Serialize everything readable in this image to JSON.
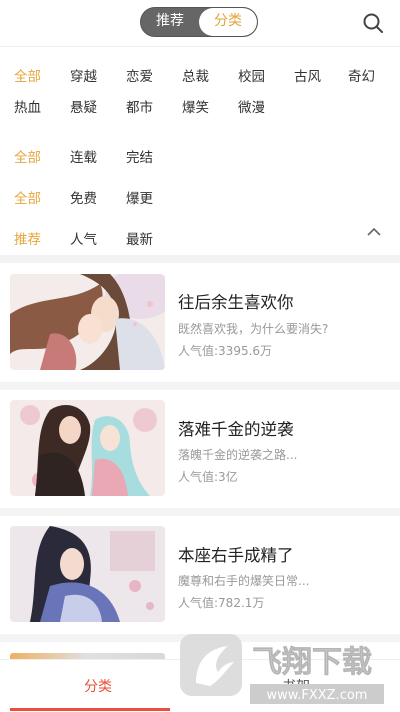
{
  "header": {
    "tabs": [
      "推荐",
      "分类"
    ],
    "active_tab": "分类",
    "search_icon": "search-icon"
  },
  "filters": {
    "genre": [
      "全部",
      "穿越",
      "恋爱",
      "总裁",
      "校园",
      "古风",
      "奇幻",
      "热血",
      "悬疑",
      "都市",
      "爆笑",
      "微漫"
    ],
    "status": [
      "全部",
      "连载",
      "完结"
    ],
    "price": [
      "全部",
      "免费",
      "爆更"
    ],
    "sort": [
      "推荐",
      "人气",
      "最新"
    ],
    "collapse_icon": "chevron-up-icon"
  },
  "comics": [
    {
      "title": "往后余生喜欢你",
      "desc": "既然喜欢我，为什么要消失?",
      "popularity": "人气值:3395.6万"
    },
    {
      "title": "落难千金的逆袭",
      "desc": "落魄千金的逆袭之路...",
      "popularity": "人气值:3亿"
    },
    {
      "title": "本座右手成精了",
      "desc": "魔尊和右手的爆笑日常...",
      "popularity": "人气值:782.1万"
    }
  ],
  "tabbar": {
    "category": "分类",
    "other": "书架"
  },
  "watermark": {
    "brand": "飞翔下载",
    "url": "www.FXXZ.com"
  },
  "colors": {
    "accent": "#e8a53c",
    "tab_active": "#e8503a"
  }
}
